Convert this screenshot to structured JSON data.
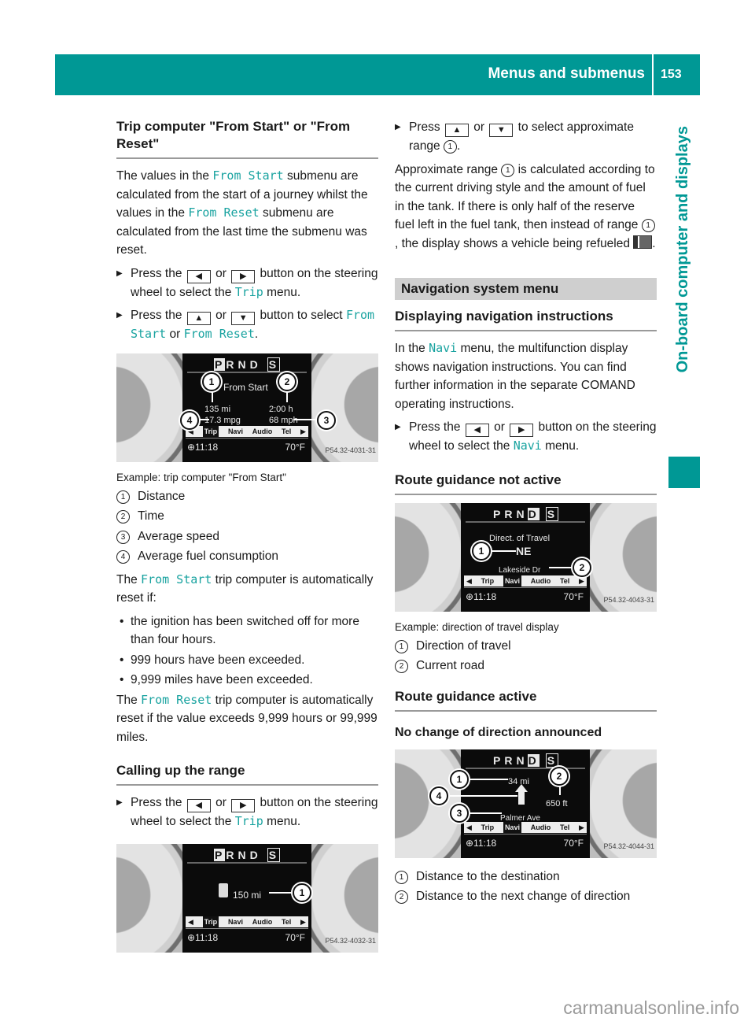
{
  "header": {
    "section": "Menus and submenus",
    "page_number": "153",
    "chapter_tab": "On-board computer and displays"
  },
  "colors": {
    "accent": "#009895",
    "mono_text": "#19a3a0",
    "band": "#cfcfcf"
  },
  "left": {
    "trip_title": "Trip computer \"From Start\" or \"From Reset\"",
    "intro": {
      "t1": "The values in the ",
      "m1": "From Start",
      "t2": " submenu are calculated from the start of a journey whilst the values in the ",
      "m2": "From Reset",
      "t3": " submenu are calculated from the last time the submenu was reset."
    },
    "step1": {
      "t1": "Press the ",
      "k1": "◀",
      "t2": " or ",
      "k2": "▶",
      "t3": " button on the steering wheel to select the ",
      "m1": "Trip",
      "t4": " menu."
    },
    "step2": {
      "t1": "Press the ",
      "k1": "▲",
      "t2": " or ",
      "k2": "▼",
      "t3": " button to select ",
      "m1": "From Start",
      "t4": " or ",
      "m2": "From Reset",
      "t5": "."
    },
    "figure1": {
      "gears": [
        "P",
        "R",
        "N",
        "D"
      ],
      "sport": "S",
      "title": "From Start",
      "distance": "135 mi",
      "time": "2:00 h",
      "fuel": "17.3 mpg",
      "speed": "68 mph",
      "menu": [
        "◀",
        "Trip",
        "Navi",
        "Audio",
        "Tel",
        "▶"
      ],
      "clock": "⊕11:18",
      "temp": "70°F",
      "code": "P54.32-4031-31",
      "callouts": [
        "1",
        "2",
        "3",
        "4"
      ]
    },
    "figure1_caption": "Example: trip computer \"From Start\"",
    "legend1": [
      {
        "num": "1",
        "label": "Distance"
      },
      {
        "num": "2",
        "label": "Time"
      },
      {
        "num": "3",
        "label": "Average speed"
      },
      {
        "num": "4",
        "label": "Average fuel consumption"
      }
    ],
    "reset_intro": {
      "t1": "The ",
      "m1": "From Start",
      "t2": " trip computer is automatically reset if:"
    },
    "reset_bullets": [
      "the ignition has been switched off for more than four hours.",
      "999 hours have been exceeded.",
      "9,999 miles have been exceeded."
    ],
    "reset2": {
      "t1": "The ",
      "m1": "From Reset",
      "t2": " trip computer is automatically reset if the value exceeds 9,999 hours or 99,999 miles."
    },
    "range_title": "Calling up the range",
    "step3": {
      "t1": "Press the ",
      "k1": "◀",
      "t2": " or ",
      "k2": "▶",
      "t3": " button on the steering wheel to select the ",
      "m1": "Trip",
      "t4": " menu."
    },
    "figure2": {
      "range": "150 mi",
      "menu": [
        "◀",
        "Trip",
        "Navi",
        "Audio",
        "Tel",
        "▶"
      ],
      "clock": "⊕11:18",
      "temp": "70°F",
      "code": "P54.32-4032-31",
      "callouts": [
        "1"
      ]
    }
  },
  "right": {
    "step4": {
      "t1": "Press ",
      "k1": "▲",
      "t2": " or ",
      "k2": "▼",
      "t3": " to select approximate range ",
      "c1": "1",
      "t4": "."
    },
    "range_text": {
      "t1": "Approximate range ",
      "c1": "1",
      "t2": " is calculated according to the current driving style and the amount of fuel in the tank. If there is only half of the reserve fuel left in the fuel tank, then instead of range ",
      "c2": "1",
      "t3": ", the display shows a vehicle being refueled ",
      "t4": "."
    },
    "nav_band": "Navigation system menu",
    "nav_title": "Displaying navigation instructions",
    "nav_intro": {
      "t1": "In the ",
      "m1": "Navi",
      "t2": " menu, the multifunction display shows navigation instructions. You can find further information in the separate COMAND operating instructions."
    },
    "step5": {
      "t1": "Press the ",
      "k1": "◀",
      "t2": " or ",
      "k2": "▶",
      "t3": " button on the steering wheel to select the ",
      "m1": "Navi",
      "t4": " menu."
    },
    "not_active_title": "Route guidance not active",
    "figure3": {
      "heading": "Direct. of Travel",
      "direction": "NE",
      "road": "Lakeside Dr",
      "menu": [
        "◀",
        "Trip",
        "Navi",
        "Audio",
        "Tel",
        "▶"
      ],
      "clock": "⊕11:18",
      "temp": "70°F",
      "code": "P54.32-4043-31",
      "callouts": [
        "1",
        "2"
      ]
    },
    "figure3_caption": "Example: direction of travel display",
    "legend3": [
      {
        "num": "1",
        "label": "Direction of travel"
      },
      {
        "num": "2",
        "label": "Current road"
      }
    ],
    "active_title": "Route guidance active",
    "no_change_title": "No change of direction announced",
    "figure4": {
      "dest_distance": "34 mi",
      "next_distance": "650 ft",
      "road": "Palmer Ave",
      "menu": [
        "◀",
        "Trip",
        "Navi",
        "Audio",
        "Tel",
        "▶"
      ],
      "clock": "⊕11:18",
      "temp": "70°F",
      "code": "P54.32-4044-31",
      "callouts": [
        "1",
        "2",
        "3",
        "4"
      ]
    },
    "legend4": [
      {
        "num": "1",
        "label": "Distance to the destination"
      },
      {
        "num": "2",
        "label": "Distance to the next change of direction"
      }
    ]
  },
  "watermark": "carmanualsonline.info"
}
